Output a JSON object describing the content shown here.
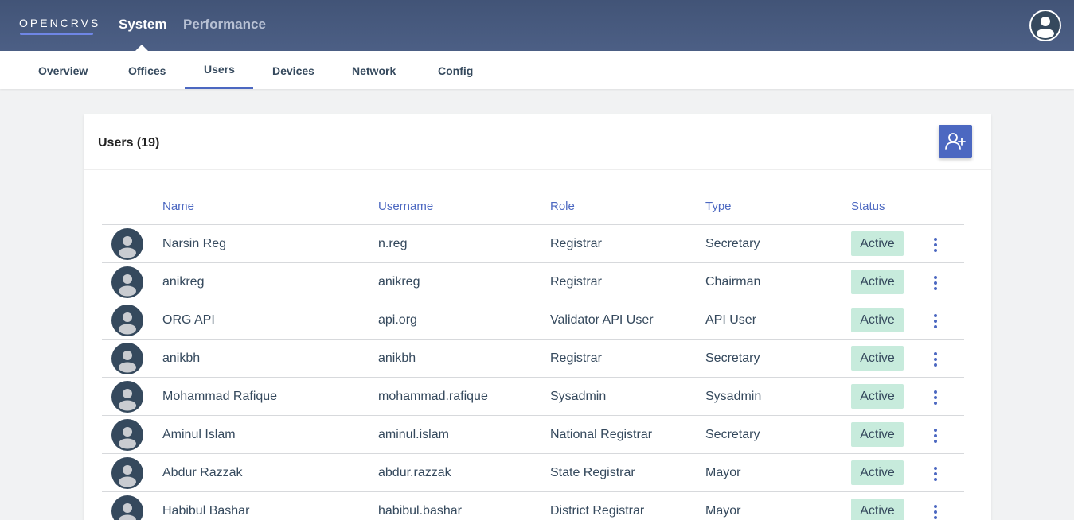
{
  "header": {
    "logo": "OPENCRVS",
    "nav": [
      {
        "label": "System"
      },
      {
        "label": "Performance"
      }
    ]
  },
  "subnav": {
    "tabs": [
      {
        "label": "Overview"
      },
      {
        "label": "Offices"
      },
      {
        "label": "Users"
      },
      {
        "label": "Devices"
      },
      {
        "label": "Network"
      },
      {
        "label": "Config"
      }
    ],
    "active": "Users"
  },
  "card": {
    "title": "Users (19)",
    "add_icon": "add-user-icon"
  },
  "table": {
    "headers": {
      "name": "Name",
      "username": "Username",
      "role": "Role",
      "type": "Type",
      "status": "Status"
    },
    "rows": [
      {
        "name": "Narsin Reg",
        "username": "n.reg",
        "role": "Registrar",
        "type": "Secretary",
        "status": "Active"
      },
      {
        "name": "anikreg",
        "username": "anikreg",
        "role": "Registrar",
        "type": "Chairman",
        "status": "Active"
      },
      {
        "name": "ORG API",
        "username": "api.org",
        "role": "Validator API User",
        "type": "API User",
        "status": "Active"
      },
      {
        "name": "anikbh",
        "username": "anikbh",
        "role": "Registrar",
        "type": "Secretary",
        "status": "Active"
      },
      {
        "name": "Mohammad Rafique",
        "username": "mohammad.rafique",
        "role": "Sysadmin",
        "type": "Sysadmin",
        "status": "Active"
      },
      {
        "name": "Aminul Islam",
        "username": "aminul.islam",
        "role": "National Registrar",
        "type": "Secretary",
        "status": "Active"
      },
      {
        "name": "Abdur Razzak",
        "username": "abdur.razzak",
        "role": "State Registrar",
        "type": "Mayor",
        "status": "Active"
      },
      {
        "name": "Habibul Bashar",
        "username": "habibul.bashar",
        "role": "District Registrar",
        "type": "Mayor",
        "status": "Active"
      }
    ]
  },
  "colors": {
    "header_bg": "#4c5f85",
    "accent": "#4c68c1",
    "status_active_bg": "#c7ebdc",
    "text": "#35495d"
  }
}
